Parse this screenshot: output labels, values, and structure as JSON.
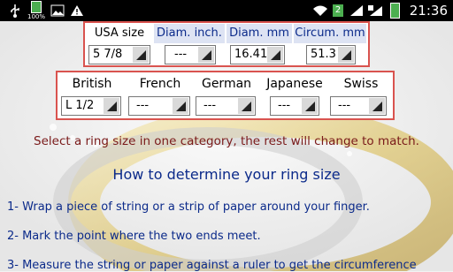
{
  "status_bar": {
    "time": "21:36",
    "battery_percent": "100%",
    "notification_count": "2",
    "icons": [
      "usb-icon",
      "battery-icon",
      "image-icon",
      "warning-icon",
      "wifi-icon",
      "sim-icon",
      "signal-icon",
      "roaming-signal-icon",
      "battery-status-icon"
    ]
  },
  "top_table": {
    "headers": [
      "USA size",
      "Diam. inch.",
      "Diam. mm",
      "Circum. mm"
    ],
    "values": [
      "5 7/8",
      "---",
      "16.41",
      "51.3"
    ]
  },
  "bottom_table": {
    "headers": [
      "British",
      "French",
      "German",
      "Japanese",
      "Swiss"
    ],
    "values": [
      "L 1/2",
      "---",
      "---",
      "---",
      "---"
    ]
  },
  "hint_text": "Select a ring size in one category, the rest will change to match.",
  "howto_title": "How to determine your ring size",
  "steps": [
    "1- Wrap a piece of string or a strip of paper around your finger.",
    "2- Mark the point where the two ends meet.",
    "3- Measure the string or paper against a ruler to get the circumference"
  ],
  "colors": {
    "table_border": "#d9534f",
    "header_bg": "#dde3f3",
    "header_text": "#0b2a8a",
    "hint_text": "#7a1a1a",
    "body_text": "#0b2a8a"
  }
}
